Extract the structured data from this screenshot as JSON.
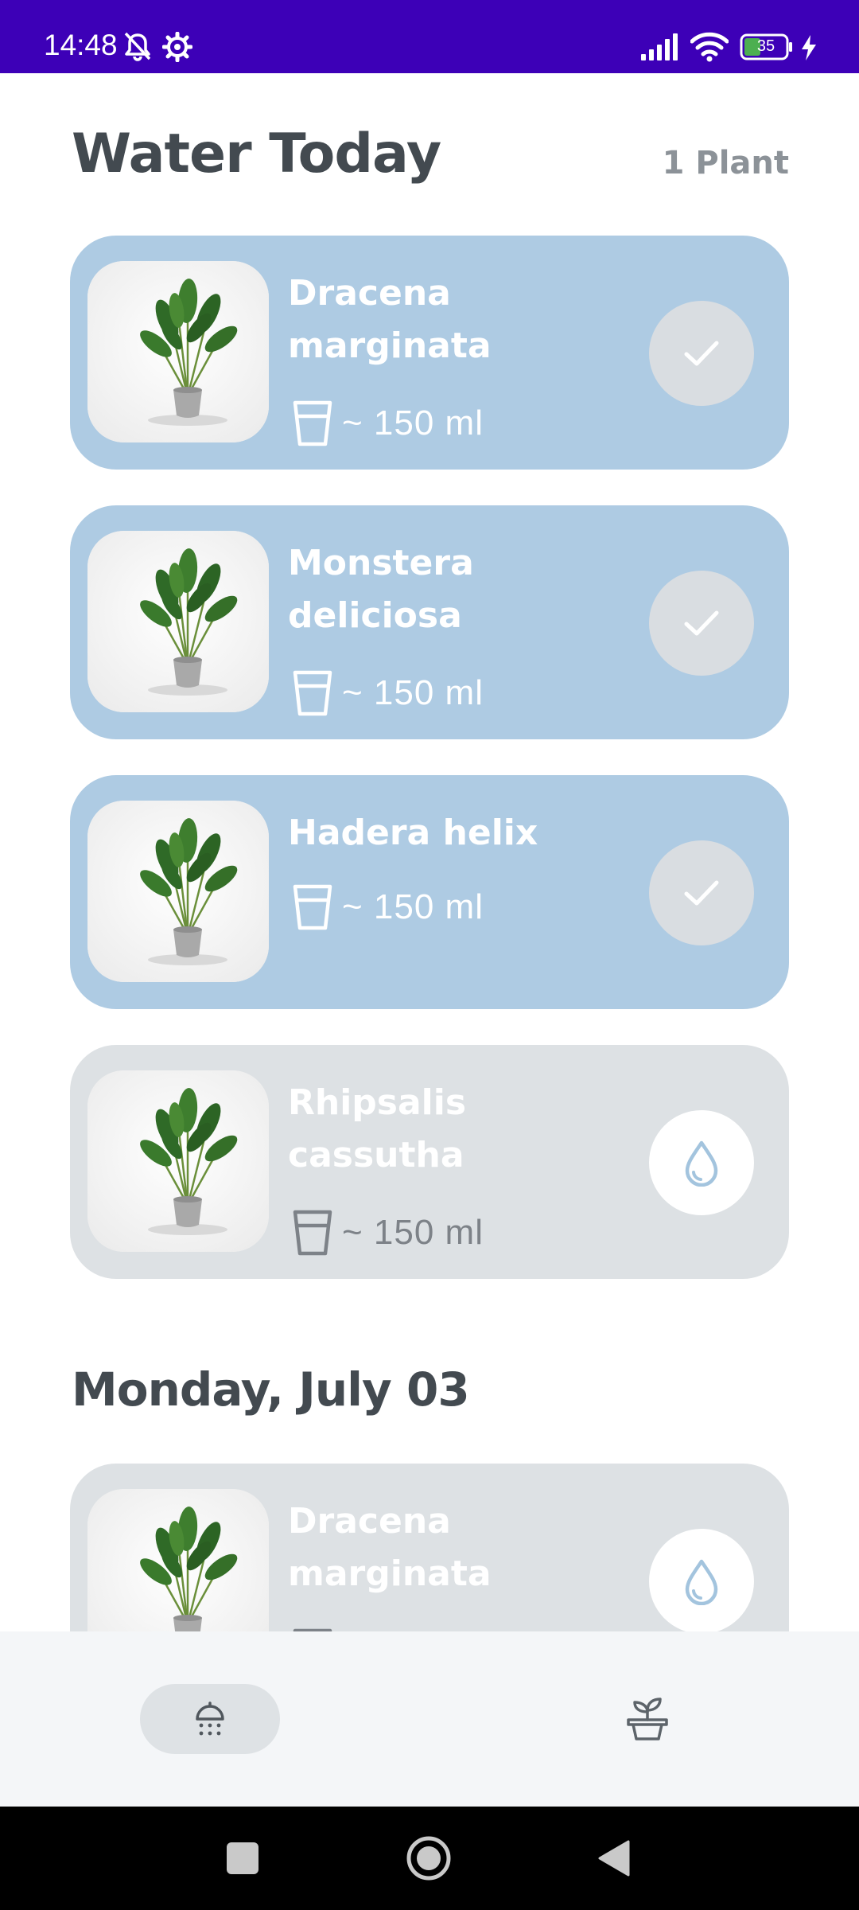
{
  "status_bar": {
    "time": "14:48",
    "battery": "35",
    "icons": [
      "bell-off-icon",
      "settings-icon",
      "signal-icon",
      "wifi-icon",
      "battery-icon",
      "charging-icon"
    ]
  },
  "header": {
    "title": "Water Today",
    "count": "1 Plant"
  },
  "today_plants": [
    {
      "name": "Dracena marginata",
      "amount": "~ 150 ml",
      "state": "done",
      "action_icon": "check-icon"
    },
    {
      "name": "Monstera deliciosa",
      "amount": "~ 150 ml",
      "state": "done",
      "action_icon": "check-icon"
    },
    {
      "name": "Hadera helix",
      "amount": "~ 150 ml",
      "state": "done",
      "action_icon": "check-icon"
    },
    {
      "name": "Rhipsalis cassutha",
      "amount": "~ 150 ml",
      "state": "pending",
      "action_icon": "water-drop-icon"
    }
  ],
  "upcoming": {
    "date": "Monday, July 03",
    "plants": [
      {
        "name": "Dracena marginata",
        "state": "pending",
        "action_icon": "water-drop-icon"
      }
    ]
  },
  "bottom_nav": [
    {
      "icon": "watering-can-icon",
      "selected": true
    },
    {
      "icon": "potted-plant-icon",
      "selected": false
    }
  ],
  "system_nav": [
    "recents-icon",
    "home-icon",
    "back-icon"
  ],
  "colors": {
    "status_bar": "#3d00b7",
    "card_done": "#aecbe3",
    "card_pending": "#dde1e4",
    "title_text": "#434a50",
    "water_drop": "#a3c4de"
  }
}
